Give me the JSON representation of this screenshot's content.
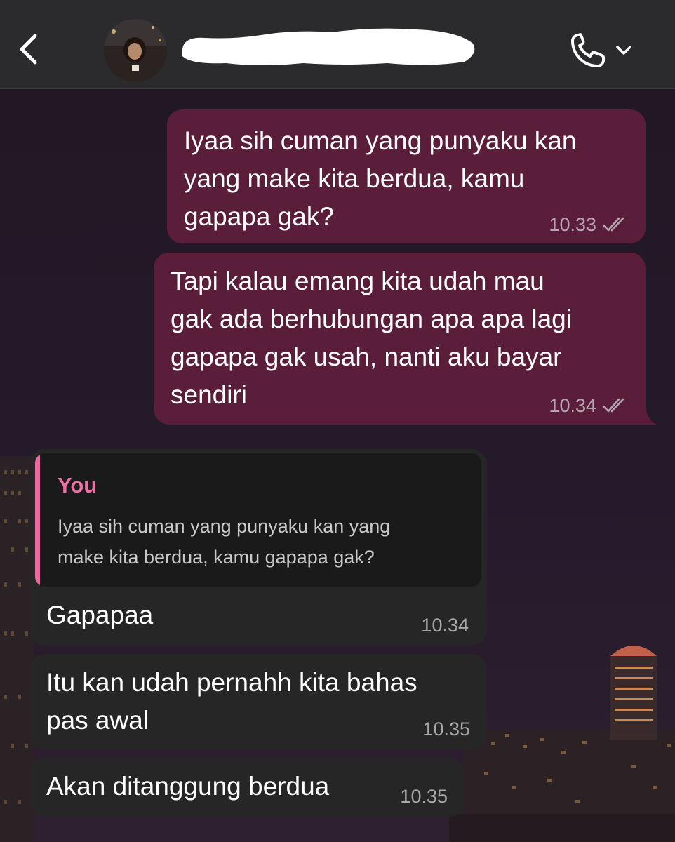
{
  "header": {
    "contact_name": "",
    "back_icon": "chevron-left-icon",
    "call_icon": "phone-icon",
    "call_menu_icon": "chevron-down-icon"
  },
  "colors": {
    "outgoing_bubble": "#5a1e3a",
    "incoming_bubble": "#262626",
    "quote_accent": "#e86a9e"
  },
  "messages": [
    {
      "direction": "out",
      "text": "Iyaa sih cuman yang punyaku kan\nyang make kita berdua, kamu\ngapapa gak?",
      "time": "10.33",
      "status": "read"
    },
    {
      "direction": "out",
      "text": "Tapi kalau emang kita udah mau\ngak ada berhubungan apa apa lagi\ngapapa gak usah, nanti aku bayar\nsendiri",
      "time": "10.34",
      "status": "read"
    },
    {
      "direction": "in",
      "reply_to": {
        "author": "You",
        "text": "Iyaa sih cuman yang punyaku kan yang\nmake kita berdua, kamu gapapa gak?"
      },
      "text": "Gapapaa",
      "time": "10.34"
    },
    {
      "direction": "in",
      "text": "Itu kan udah pernahh kita bahas\npas awal",
      "time": "10.35"
    },
    {
      "direction": "in",
      "text": "Akan ditanggung berdua",
      "time": "10.35"
    }
  ]
}
